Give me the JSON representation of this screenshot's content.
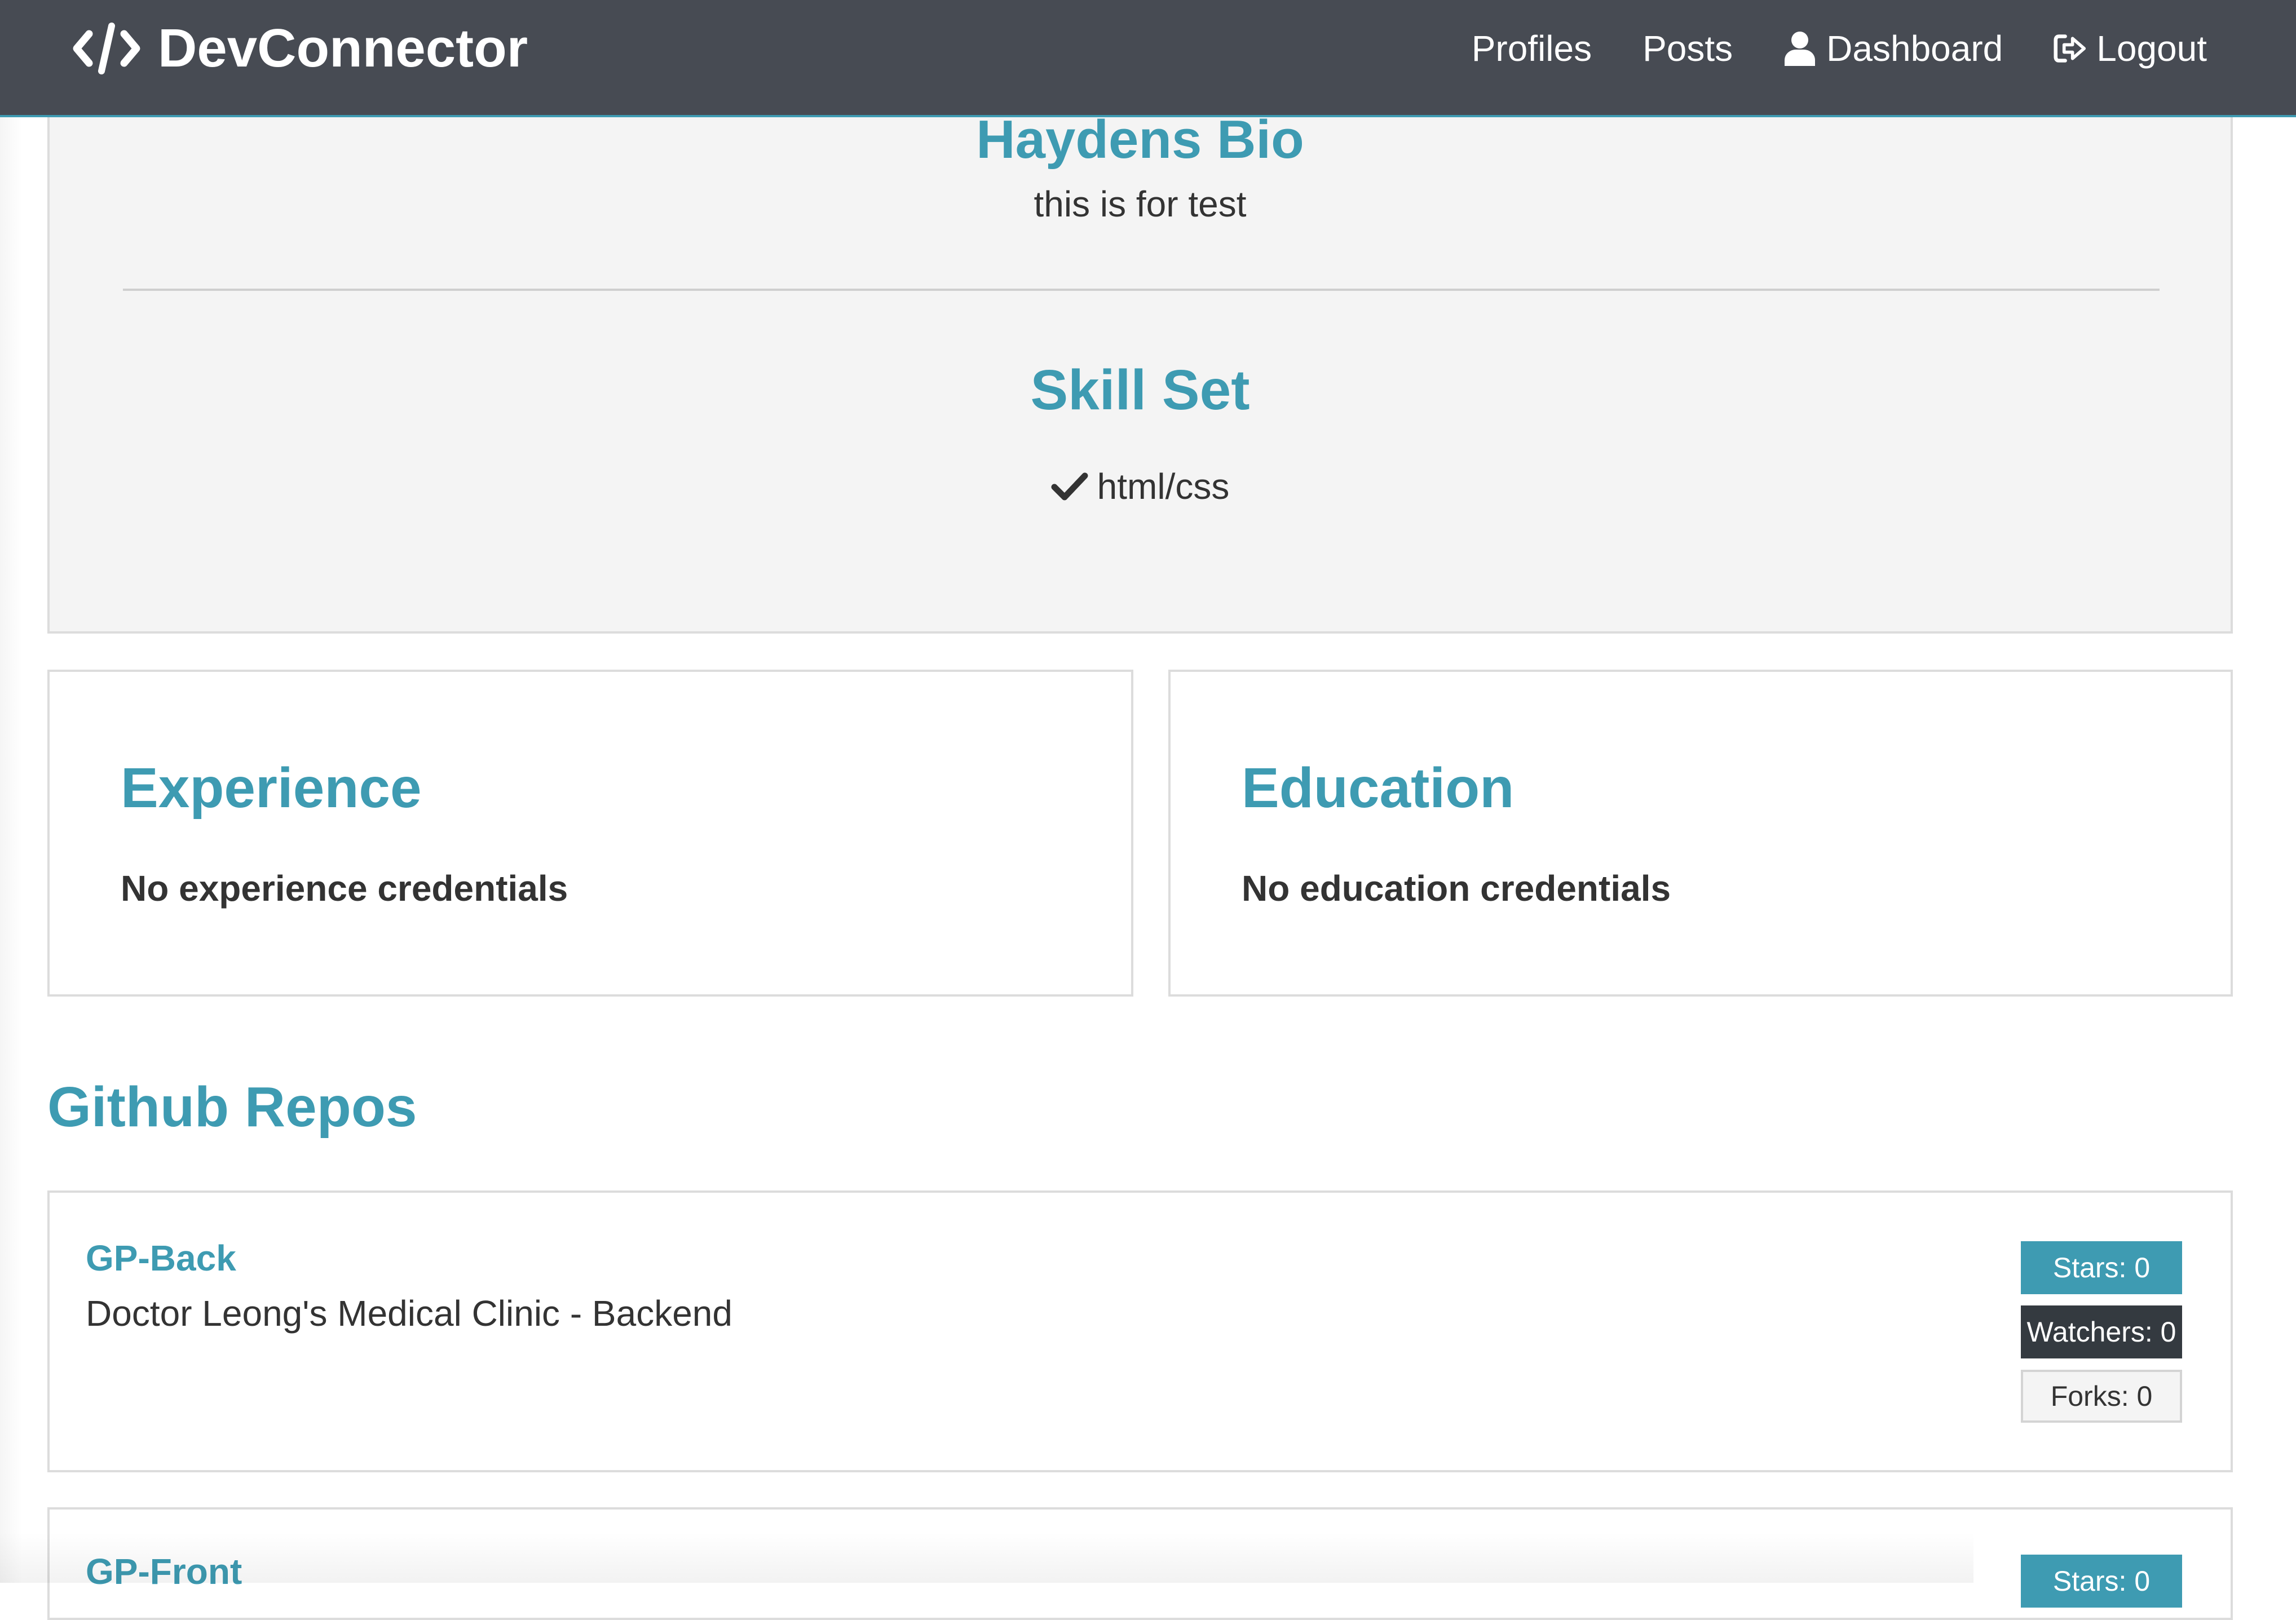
{
  "navbar": {
    "brand": "DevConnector",
    "brand_icon": "code-icon",
    "links": [
      {
        "label": "Profiles",
        "icon": null
      },
      {
        "label": "Posts",
        "icon": null
      },
      {
        "label": "Dashboard",
        "icon": "user-icon"
      },
      {
        "label": "Logout",
        "icon": "sign-out-icon"
      }
    ]
  },
  "profile": {
    "bio_title": "Haydens Bio",
    "bio_text": "this is for test",
    "skills_title": "Skill Set",
    "skills": [
      "html/css"
    ]
  },
  "experience": {
    "title": "Experience",
    "empty_text": "No experience credentials"
  },
  "education": {
    "title": "Education",
    "empty_text": "No education credentials"
  },
  "github": {
    "title": "Github Repos",
    "repos": [
      {
        "name": "GP-Back",
        "description": "Doctor Leong's Medical Clinic - Backend",
        "stars": "Stars: 0",
        "watchers": "Watchers: 0",
        "forks": "Forks: 0"
      },
      {
        "name": "GP-Front",
        "description": "",
        "stars": "Stars: 0"
      }
    ]
  },
  "colors": {
    "primary": "#3e9bb2",
    "navbar": "#474b53",
    "dark": "#343a40",
    "light": "#f4f4f4"
  }
}
